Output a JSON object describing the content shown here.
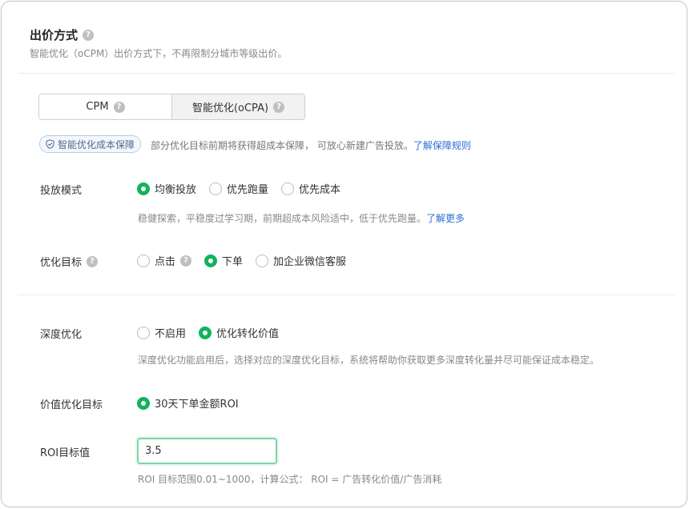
{
  "section": {
    "title": "出价方式",
    "subtitle": "智能优化（oCPM）出价方式下，不再限制分城市等级出价。"
  },
  "bid_mode": {
    "options": [
      "CPM",
      "智能优化(oCPA)"
    ],
    "selected": "智能优化(oCPA)"
  },
  "guarantee": {
    "tag": "智能优化成本保障",
    "desc": "部分优化目标前期将获得超成本保障， 可放心新建广告投放。",
    "link": "了解保障规则"
  },
  "delivery_mode": {
    "label": "投放模式",
    "options": [
      "均衡投放",
      "优先跑量",
      "优先成本"
    ],
    "selected": "均衡投放",
    "hint": "稳健探索，平稳度过学习期，前期超成本风险适中，低于优先跑量。",
    "hint_link": "了解更多"
  },
  "optimize_goal": {
    "label": "优化目标",
    "options": [
      "点击",
      "下单",
      "加企业微信客服"
    ],
    "selected": "下单"
  },
  "deep_optimize": {
    "label": "深度优化",
    "options": [
      "不启用",
      "优化转化价值"
    ],
    "selected": "优化转化价值",
    "hint": "深度优化功能启用后，选择对应的深度优化目标，系统将帮助你获取更多深度转化量并尽可能保证成本稳定。"
  },
  "value_goal": {
    "label": "价值优化目标",
    "options": [
      "30天下单金额ROI"
    ],
    "selected": "30天下单金额ROI"
  },
  "roi": {
    "label": "ROI目标值",
    "value": "3.5",
    "hint": "ROI 目标范围0.01~1000，计算公式： ROI = 广告转化价值/广告消耗"
  },
  "colors": {
    "accent": "#11b35c",
    "link": "#2b6fd6"
  }
}
